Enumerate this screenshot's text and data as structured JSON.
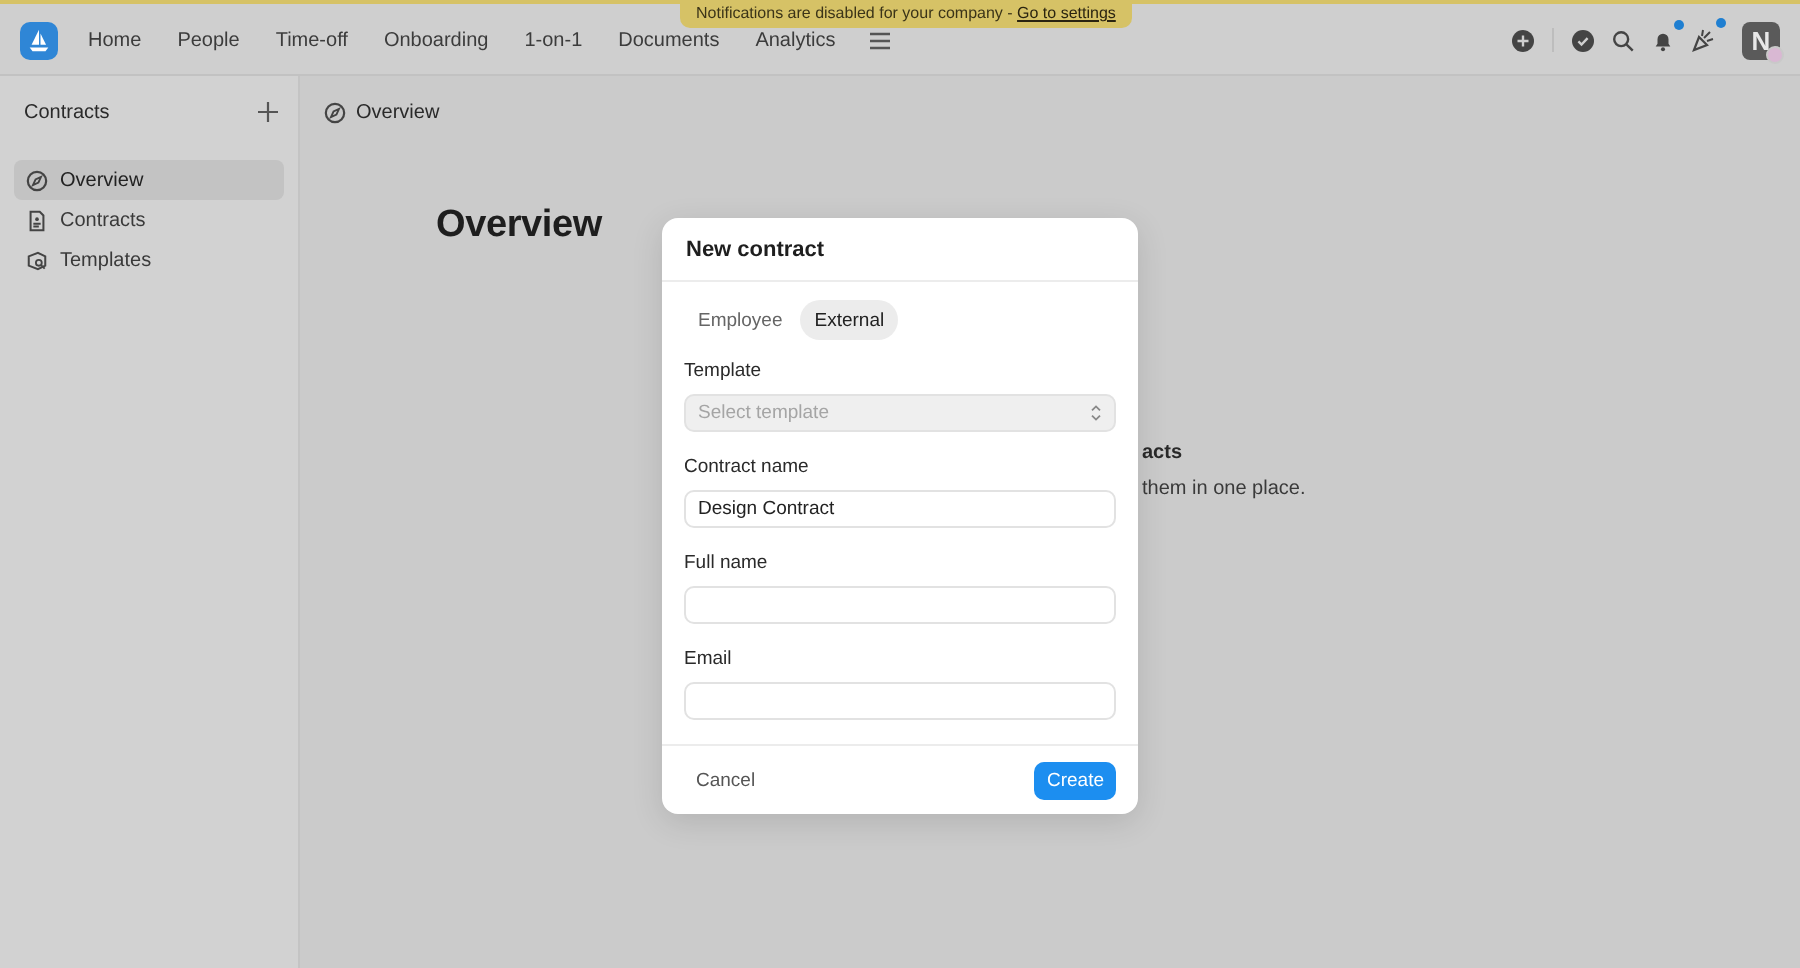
{
  "banner": {
    "text": "Notifications are disabled for your company - ",
    "link": "Go to settings"
  },
  "nav": [
    {
      "label": "Home"
    },
    {
      "label": "People"
    },
    {
      "label": "Time-off"
    },
    {
      "label": "Onboarding"
    },
    {
      "label": "1-on-1"
    },
    {
      "label": "Documents"
    },
    {
      "label": "Analytics"
    }
  ],
  "toolbar": {
    "bell_unread": true,
    "updates_unread": true,
    "avatar_initial": "N"
  },
  "sidebar": {
    "title": "Contracts",
    "items": [
      {
        "label": "Overview",
        "kind": "compass",
        "selected": true
      },
      {
        "label": "Contracts",
        "kind": "document",
        "selected": false
      },
      {
        "label": "Templates",
        "kind": "template",
        "selected": false
      }
    ]
  },
  "breadcrumb": "Overview",
  "heading": "Overview",
  "empty_state": {
    "title": "acts",
    "text": "them in one place."
  },
  "dialog": {
    "title": "New contract",
    "tabs": [
      {
        "label": "Employee",
        "selected": false
      },
      {
        "label": "External",
        "selected": true
      }
    ],
    "fields": [
      {
        "label": "Template",
        "kind": "select",
        "placeholder": "Select template",
        "disabled": true
      },
      {
        "label": "Contract name",
        "kind": "text",
        "value": "Design Contract",
        "disabled": false
      },
      {
        "label": "Full name",
        "kind": "text",
        "disabled": false
      },
      {
        "label": "Email",
        "kind": "text",
        "disabled": false
      }
    ],
    "buttons": [
      {
        "label": "Cancel",
        "kind": "secondary"
      },
      {
        "label": "Create",
        "kind": "primary"
      }
    ]
  }
}
